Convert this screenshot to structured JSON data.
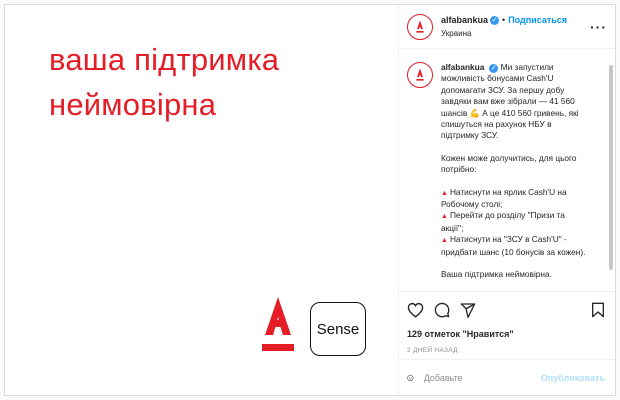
{
  "post": {
    "headline": [
      "ваша підтримка",
      "неймовірна"
    ],
    "sense_label": "Sense"
  },
  "header": {
    "username": "alfabankua",
    "separator": "•",
    "follow_label": "Подписаться",
    "location": "Украина",
    "more_label": "···"
  },
  "caption": {
    "username": "alfabankua",
    "intro_lines": [
      "Ми запустили",
      "можливість бонусами Cash'U",
      "допомагати ЗСУ. За першу добу",
      "завдяки вам вже зібрали — 41 560",
      "шансів 💪 А це 410 560 гривень, які",
      "спишуться на рахунок НБУ в",
      "підтримку ЗСУ."
    ],
    "how_lines": [
      "Кожен може долучитись, для цього",
      "потрібно:"
    ],
    "steps": [
      [
        "Натиснути на ярлик Cash'U на",
        "Робочому столі;"
      ],
      [
        "Перейти до розділу \"Призи та",
        "акції\";"
      ],
      [
        "Натиснути на \"ЗСУ в Cash'U\" -",
        "придбати шанс (10 бонусів за кожен)."
      ]
    ],
    "closing": "Ваша підтримка неймовірна."
  },
  "actions": {
    "likes": "129 отметок \"Нравится\"",
    "timestamp": "2 дней назад"
  },
  "comment": {
    "placeholder": "Добавьте",
    "publish_label": "Опубликовать"
  },
  "colors": {
    "brand_red": "#e41d26",
    "link_blue": "#0095f6",
    "publish_disabled": "#b2dffc"
  }
}
